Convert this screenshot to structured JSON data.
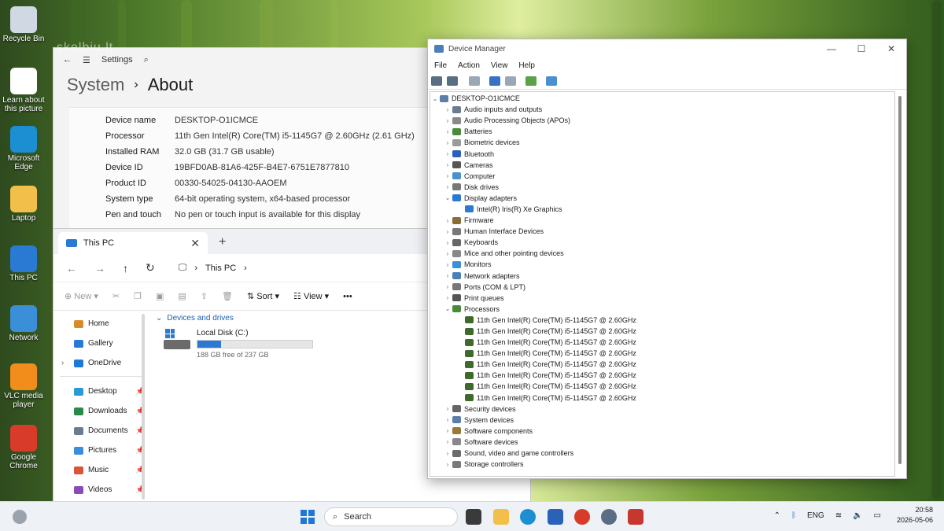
{
  "colors": {
    "accent": "#2a7ad4",
    "folder": "#f2c04a"
  },
  "desktop": {
    "icons": [
      {
        "label": "Recycle Bin",
        "icon": "recycle-bin-icon"
      },
      {
        "label": "Learn about this picture",
        "icon": "camera-icon"
      },
      {
        "label": "Microsoft Edge",
        "icon": "edge-icon"
      },
      {
        "label": "Laptop",
        "icon": "user-folder-icon"
      },
      {
        "label": "This PC",
        "icon": "monitor-icon"
      },
      {
        "label": "Network",
        "icon": "network-icon"
      },
      {
        "label": "VLC media player",
        "icon": "vlc-icon"
      },
      {
        "label": "Google Chrome",
        "icon": "chrome-icon"
      }
    ],
    "watermark": "skelbiu.lt"
  },
  "settings": {
    "app_title": "Settings",
    "breadcrumb_parent": "System",
    "breadcrumb_current": "About",
    "specs": [
      {
        "key": "Device name",
        "value": "DESKTOP-O1ICMCE"
      },
      {
        "key": "Processor",
        "value": "11th Gen Intel(R) Core(TM) i5-1145G7 @ 2.60GHz (2.61 GHz)"
      },
      {
        "key": "Installed RAM",
        "value": "32.0 GB (31.7 GB usable)"
      },
      {
        "key": "Device ID",
        "value": "19BFD0AB-81A6-425F-B4E7-6751E7877810"
      },
      {
        "key": "Product ID",
        "value": "00330-54025-04130-AAOEM"
      },
      {
        "key": "System type",
        "value": "64-bit operating system, x64-based processor"
      },
      {
        "key": "Pen and touch",
        "value": "No pen or touch input is available for this display"
      }
    ]
  },
  "explorer": {
    "tab_title": "This PC",
    "address": "This PC",
    "commands": {
      "new": "New",
      "sort": "Sort",
      "view": "View"
    },
    "sidebar": [
      {
        "label": "Home",
        "icon": "home-icon",
        "pinned": false
      },
      {
        "label": "Gallery",
        "icon": "gallery-icon",
        "pinned": false
      },
      {
        "label": "OneDrive",
        "icon": "cloud-icon",
        "pinned": false
      },
      {
        "label": "Desktop",
        "icon": "desktop-folder-icon",
        "pinned": true
      },
      {
        "label": "Downloads",
        "icon": "download-icon",
        "pinned": true
      },
      {
        "label": "Documents",
        "icon": "document-icon",
        "pinned": true
      },
      {
        "label": "Pictures",
        "icon": "picture-icon",
        "pinned": true
      },
      {
        "label": "Music",
        "icon": "music-icon",
        "pinned": true
      },
      {
        "label": "Videos",
        "icon": "video-icon",
        "pinned": true
      }
    ],
    "group_header": "Devices and drives",
    "drive": {
      "name": "Local Disk (C:)",
      "free_text": "188 GB free of 237 GB",
      "used_fraction": 0.207
    }
  },
  "device_manager": {
    "title": "Device Manager",
    "menu": [
      "File",
      "Action",
      "View",
      "Help"
    ],
    "root": "DESKTOP-O1ICMCE",
    "nodes": [
      {
        "label": "Audio inputs and outputs",
        "expanded": false,
        "children": []
      },
      {
        "label": "Audio Processing Objects (APOs)",
        "expanded": false,
        "children": []
      },
      {
        "label": "Batteries",
        "expanded": false,
        "children": []
      },
      {
        "label": "Biometric devices",
        "expanded": false,
        "children": []
      },
      {
        "label": "Bluetooth",
        "expanded": false,
        "children": []
      },
      {
        "label": "Cameras",
        "expanded": false,
        "children": []
      },
      {
        "label": "Computer",
        "expanded": false,
        "children": []
      },
      {
        "label": "Disk drives",
        "expanded": false,
        "children": []
      },
      {
        "label": "Display adapters",
        "expanded": true,
        "children": [
          "Intel(R) Iris(R) Xe Graphics"
        ]
      },
      {
        "label": "Firmware",
        "expanded": false,
        "children": []
      },
      {
        "label": "Human Interface Devices",
        "expanded": false,
        "children": []
      },
      {
        "label": "Keyboards",
        "expanded": false,
        "children": []
      },
      {
        "label": "Mice and other pointing devices",
        "expanded": false,
        "children": []
      },
      {
        "label": "Monitors",
        "expanded": false,
        "children": []
      },
      {
        "label": "Network adapters",
        "expanded": false,
        "children": []
      },
      {
        "label": "Ports (COM & LPT)",
        "expanded": false,
        "children": []
      },
      {
        "label": "Print queues",
        "expanded": false,
        "children": []
      },
      {
        "label": "Processors",
        "expanded": true,
        "children": [
          "11th Gen Intel(R) Core(TM) i5-1145G7 @ 2.60GHz",
          "11th Gen Intel(R) Core(TM) i5-1145G7 @ 2.60GHz",
          "11th Gen Intel(R) Core(TM) i5-1145G7 @ 2.60GHz",
          "11th Gen Intel(R) Core(TM) i5-1145G7 @ 2.60GHz",
          "11th Gen Intel(R) Core(TM) i5-1145G7 @ 2.60GHz",
          "11th Gen Intel(R) Core(TM) i5-1145G7 @ 2.60GHz",
          "11th Gen Intel(R) Core(TM) i5-1145G7 @ 2.60GHz",
          "11th Gen Intel(R) Core(TM) i5-1145G7 @ 2.60GHz"
        ]
      },
      {
        "label": "Security devices",
        "expanded": false,
        "children": []
      },
      {
        "label": "System devices",
        "expanded": false,
        "children": []
      },
      {
        "label": "Software components",
        "expanded": false,
        "children": []
      },
      {
        "label": "Software devices",
        "expanded": false,
        "children": []
      },
      {
        "label": "Sound, video and game controllers",
        "expanded": false,
        "children": []
      },
      {
        "label": "Storage controllers",
        "expanded": false,
        "children": []
      }
    ]
  },
  "taskbar": {
    "search_placeholder": "Search",
    "language": "ENG",
    "time": "20:58",
    "date": "2026-05-06"
  }
}
